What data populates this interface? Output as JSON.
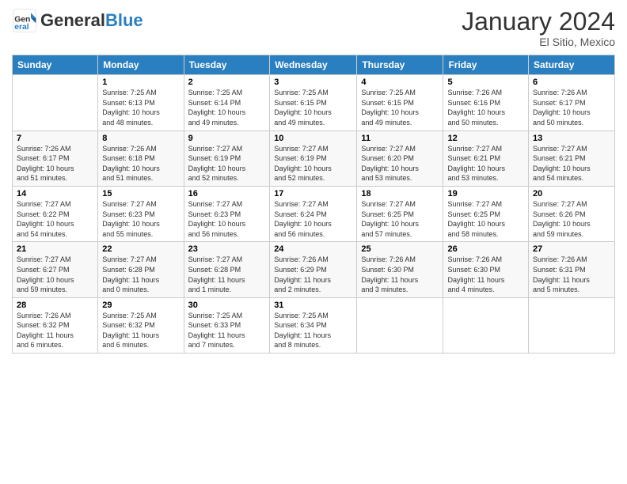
{
  "header": {
    "logo_general": "General",
    "logo_blue": "Blue",
    "month_title": "January 2024",
    "subtitle": "El Sitio, Mexico"
  },
  "days_of_week": [
    "Sunday",
    "Monday",
    "Tuesday",
    "Wednesday",
    "Thursday",
    "Friday",
    "Saturday"
  ],
  "weeks": [
    [
      {
        "num": "",
        "info": ""
      },
      {
        "num": "1",
        "info": "Sunrise: 7:25 AM\nSunset: 6:13 PM\nDaylight: 10 hours\nand 48 minutes."
      },
      {
        "num": "2",
        "info": "Sunrise: 7:25 AM\nSunset: 6:14 PM\nDaylight: 10 hours\nand 49 minutes."
      },
      {
        "num": "3",
        "info": "Sunrise: 7:25 AM\nSunset: 6:15 PM\nDaylight: 10 hours\nand 49 minutes."
      },
      {
        "num": "4",
        "info": "Sunrise: 7:25 AM\nSunset: 6:15 PM\nDaylight: 10 hours\nand 49 minutes."
      },
      {
        "num": "5",
        "info": "Sunrise: 7:26 AM\nSunset: 6:16 PM\nDaylight: 10 hours\nand 50 minutes."
      },
      {
        "num": "6",
        "info": "Sunrise: 7:26 AM\nSunset: 6:17 PM\nDaylight: 10 hours\nand 50 minutes."
      }
    ],
    [
      {
        "num": "7",
        "info": "Sunrise: 7:26 AM\nSunset: 6:17 PM\nDaylight: 10 hours\nand 51 minutes."
      },
      {
        "num": "8",
        "info": "Sunrise: 7:26 AM\nSunset: 6:18 PM\nDaylight: 10 hours\nand 51 minutes."
      },
      {
        "num": "9",
        "info": "Sunrise: 7:27 AM\nSunset: 6:19 PM\nDaylight: 10 hours\nand 52 minutes."
      },
      {
        "num": "10",
        "info": "Sunrise: 7:27 AM\nSunset: 6:19 PM\nDaylight: 10 hours\nand 52 minutes."
      },
      {
        "num": "11",
        "info": "Sunrise: 7:27 AM\nSunset: 6:20 PM\nDaylight: 10 hours\nand 53 minutes."
      },
      {
        "num": "12",
        "info": "Sunrise: 7:27 AM\nSunset: 6:21 PM\nDaylight: 10 hours\nand 53 minutes."
      },
      {
        "num": "13",
        "info": "Sunrise: 7:27 AM\nSunset: 6:21 PM\nDaylight: 10 hours\nand 54 minutes."
      }
    ],
    [
      {
        "num": "14",
        "info": "Sunrise: 7:27 AM\nSunset: 6:22 PM\nDaylight: 10 hours\nand 54 minutes."
      },
      {
        "num": "15",
        "info": "Sunrise: 7:27 AM\nSunset: 6:23 PM\nDaylight: 10 hours\nand 55 minutes."
      },
      {
        "num": "16",
        "info": "Sunrise: 7:27 AM\nSunset: 6:23 PM\nDaylight: 10 hours\nand 56 minutes."
      },
      {
        "num": "17",
        "info": "Sunrise: 7:27 AM\nSunset: 6:24 PM\nDaylight: 10 hours\nand 56 minutes."
      },
      {
        "num": "18",
        "info": "Sunrise: 7:27 AM\nSunset: 6:25 PM\nDaylight: 10 hours\nand 57 minutes."
      },
      {
        "num": "19",
        "info": "Sunrise: 7:27 AM\nSunset: 6:25 PM\nDaylight: 10 hours\nand 58 minutes."
      },
      {
        "num": "20",
        "info": "Sunrise: 7:27 AM\nSunset: 6:26 PM\nDaylight: 10 hours\nand 59 minutes."
      }
    ],
    [
      {
        "num": "21",
        "info": "Sunrise: 7:27 AM\nSunset: 6:27 PM\nDaylight: 10 hours\nand 59 minutes."
      },
      {
        "num": "22",
        "info": "Sunrise: 7:27 AM\nSunset: 6:28 PM\nDaylight: 11 hours\nand 0 minutes."
      },
      {
        "num": "23",
        "info": "Sunrise: 7:27 AM\nSunset: 6:28 PM\nDaylight: 11 hours\nand 1 minute."
      },
      {
        "num": "24",
        "info": "Sunrise: 7:26 AM\nSunset: 6:29 PM\nDaylight: 11 hours\nand 2 minutes."
      },
      {
        "num": "25",
        "info": "Sunrise: 7:26 AM\nSunset: 6:30 PM\nDaylight: 11 hours\nand 3 minutes."
      },
      {
        "num": "26",
        "info": "Sunrise: 7:26 AM\nSunset: 6:30 PM\nDaylight: 11 hours\nand 4 minutes."
      },
      {
        "num": "27",
        "info": "Sunrise: 7:26 AM\nSunset: 6:31 PM\nDaylight: 11 hours\nand 5 minutes."
      }
    ],
    [
      {
        "num": "28",
        "info": "Sunrise: 7:26 AM\nSunset: 6:32 PM\nDaylight: 11 hours\nand 6 minutes."
      },
      {
        "num": "29",
        "info": "Sunrise: 7:25 AM\nSunset: 6:32 PM\nDaylight: 11 hours\nand 6 minutes."
      },
      {
        "num": "30",
        "info": "Sunrise: 7:25 AM\nSunset: 6:33 PM\nDaylight: 11 hours\nand 7 minutes."
      },
      {
        "num": "31",
        "info": "Sunrise: 7:25 AM\nSunset: 6:34 PM\nDaylight: 11 hours\nand 8 minutes."
      },
      {
        "num": "",
        "info": ""
      },
      {
        "num": "",
        "info": ""
      },
      {
        "num": "",
        "info": ""
      }
    ]
  ]
}
